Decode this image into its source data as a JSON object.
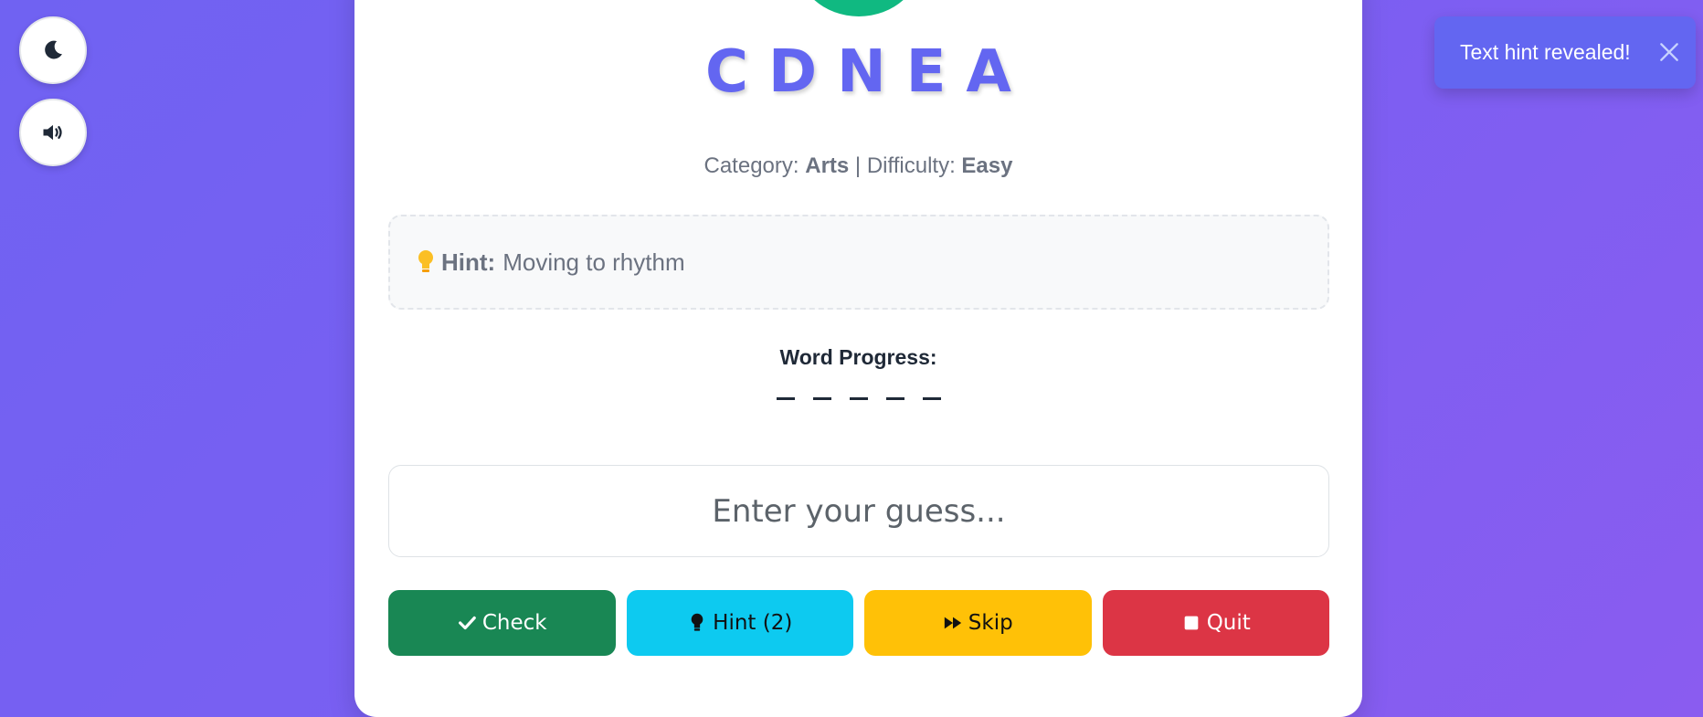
{
  "controls": {
    "theme_icon": "moon-icon",
    "sound_icon": "volume-high-icon"
  },
  "game": {
    "scrambled_word": "CDNEA",
    "category_label": "Category:",
    "category_value": "Arts",
    "separator": "|",
    "difficulty_label": "Difficulty:",
    "difficulty_value": "Easy",
    "hint_label": "Hint:",
    "hint_text": "Moving to rhythm",
    "progress_label": "Word Progress:",
    "progress_slots": [
      "_",
      "_",
      "_",
      "_",
      "_"
    ],
    "guess_placeholder": "Enter your guess..."
  },
  "buttons": {
    "check_label": "Check",
    "hint_label": "Hint (2)",
    "skip_label": "Skip",
    "quit_label": "Quit"
  },
  "toast": {
    "message": "Text hint revealed!"
  },
  "colors": {
    "accent": "#6366f1",
    "check": "#198754",
    "hint": "#0dcaf0",
    "skip": "#ffc107",
    "quit": "#dc3545",
    "avatar": "#10b981"
  }
}
